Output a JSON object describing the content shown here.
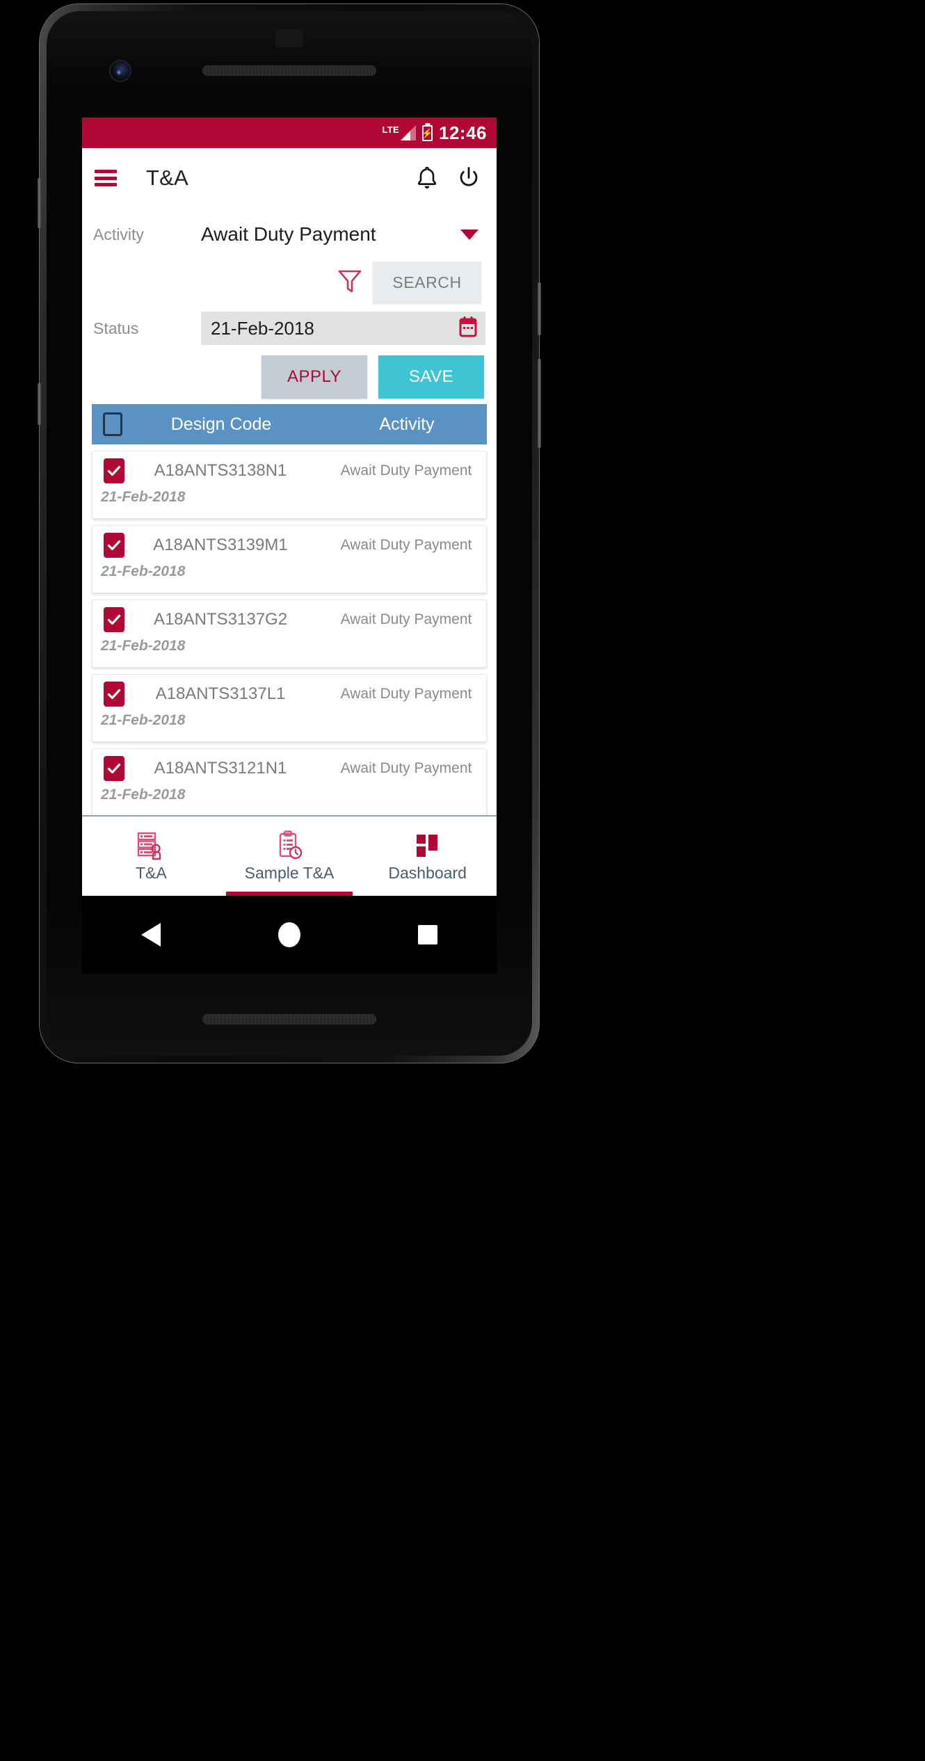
{
  "status_bar": {
    "network": "LTE",
    "time": "12:46",
    "battery_icon": "battery-charging-icon",
    "signal_icon": "signal-bars-icon"
  },
  "app_bar": {
    "menu_icon": "hamburger-menu-icon",
    "title": "T&A",
    "notification_icon": "bell-icon",
    "power_icon": "power-icon"
  },
  "filters": {
    "activity_label": "Activity",
    "activity_value": "Await Duty Payment",
    "activity_caret_icon": "chevron-down-icon",
    "filter_icon": "funnel-filter-icon",
    "search_label": "SEARCH",
    "status_label": "Status",
    "date_value": "21-Feb-2018",
    "calendar_icon": "calendar-icon",
    "apply_label": "APPLY",
    "save_label": "SAVE"
  },
  "table": {
    "columns": [
      "Design Code",
      "Activity"
    ],
    "select_all_checked": false,
    "rows": [
      {
        "checked": true,
        "code": "A18ANTS3138N1",
        "activity": "Await Duty Payment",
        "date": "21-Feb-2018"
      },
      {
        "checked": true,
        "code": "A18ANTS3139M1",
        "activity": "Await Duty Payment",
        "date": "21-Feb-2018"
      },
      {
        "checked": true,
        "code": "A18ANTS3137G2",
        "activity": "Await Duty Payment",
        "date": "21-Feb-2018"
      },
      {
        "checked": true,
        "code": "A18ANTS3137L1",
        "activity": "Await Duty Payment",
        "date": "21-Feb-2018"
      },
      {
        "checked": true,
        "code": "A18ANTS3121N1",
        "activity": "Await Duty Payment",
        "date": "21-Feb-2018"
      }
    ]
  },
  "bottom_nav": {
    "items": [
      {
        "label": "T&A",
        "icon": "server-stack-task-icon",
        "active": false
      },
      {
        "label": "Sample T&A",
        "icon": "clipboard-clock-icon",
        "active": true
      },
      {
        "label": "Dashboard",
        "icon": "dashboard-grid-icon",
        "active": false
      }
    ]
  },
  "android_nav": {
    "back_icon": "back-triangle-icon",
    "home_icon": "home-circle-icon",
    "recents_icon": "recents-square-icon"
  },
  "colors": {
    "brand_crimson": "#b00735",
    "table_header_blue": "#5b92c4",
    "save_teal": "#3ec4d2",
    "apply_gray": "#c3ccd3",
    "nav_label": "#4a5d6b"
  }
}
